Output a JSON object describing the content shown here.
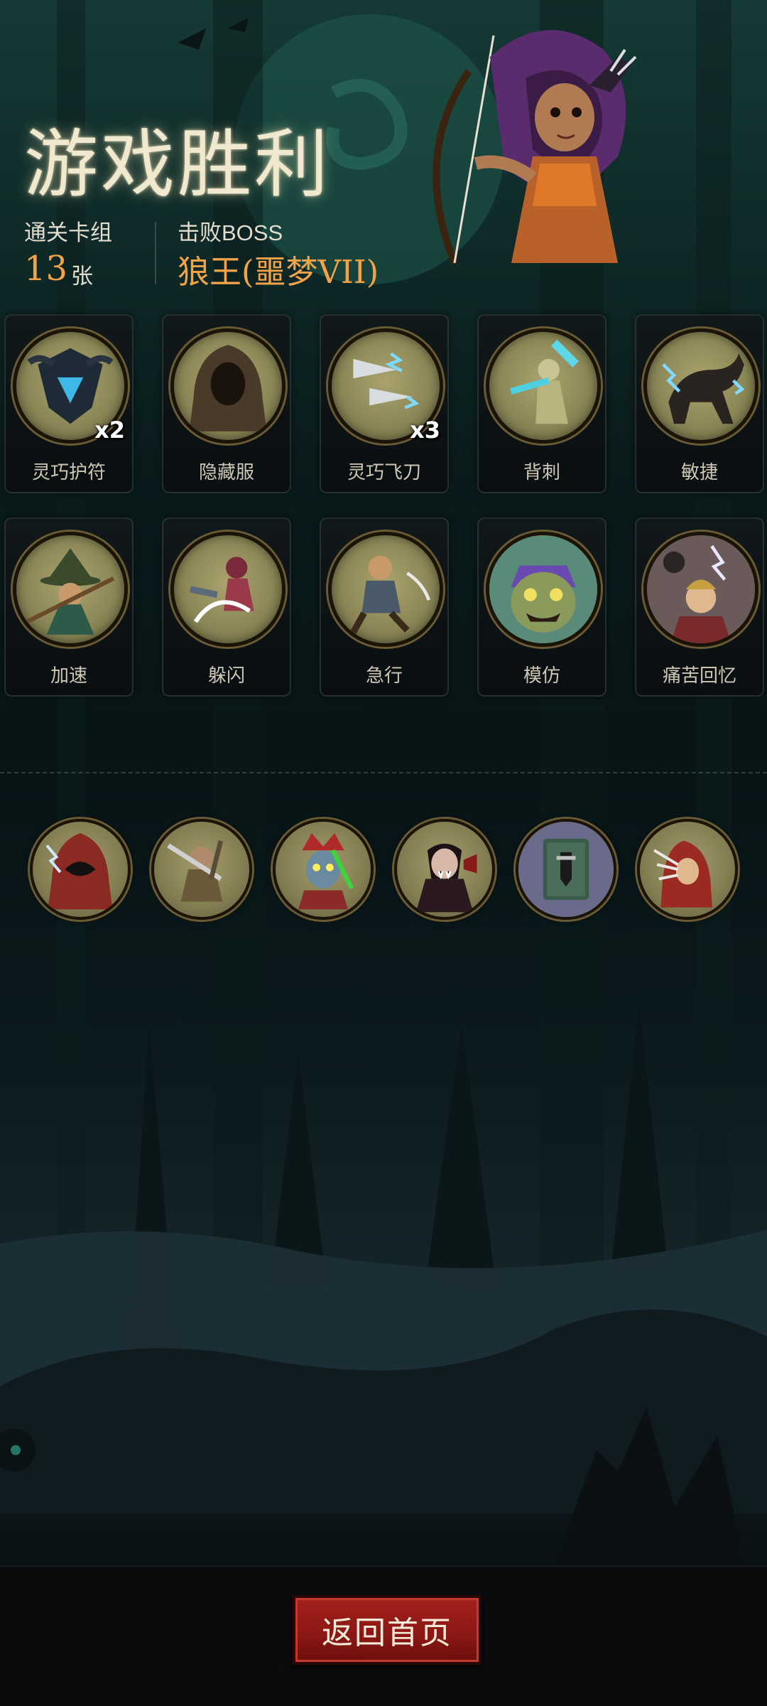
{
  "header": {
    "title": "游戏胜利",
    "deck_label": "通关卡组",
    "deck_count": "13",
    "deck_unit": "张",
    "boss_label": "击败BOSS",
    "boss_name": "狼王(噩梦VII)"
  },
  "cards": [
    {
      "label": "灵巧护符",
      "count": "x2",
      "icon": "amulet-icon"
    },
    {
      "label": "隐藏服",
      "count": "",
      "icon": "hood-icon"
    },
    {
      "label": "灵巧飞刀",
      "count": "x3",
      "icon": "throwing-knife-icon"
    },
    {
      "label": "背刺",
      "count": "",
      "icon": "backstab-icon"
    },
    {
      "label": "敏捷",
      "count": "",
      "icon": "panther-icon"
    },
    {
      "label": "加速",
      "count": "",
      "icon": "witch-icon"
    },
    {
      "label": "躲闪",
      "count": "",
      "icon": "dodge-icon"
    },
    {
      "label": "急行",
      "count": "",
      "icon": "dash-icon"
    },
    {
      "label": "模仿",
      "count": "",
      "icon": "goblin-face-icon"
    },
    {
      "label": "痛苦回忆",
      "count": "",
      "icon": "painful-memory-icon"
    }
  ],
  "relics": [
    {
      "icon": "hooded-figure-icon"
    },
    {
      "icon": "swordsman-icon"
    },
    {
      "icon": "jester-icon"
    },
    {
      "icon": "vampire-icon"
    },
    {
      "icon": "book-icon"
    },
    {
      "icon": "red-hood-icon"
    }
  ],
  "footer": {
    "home_button_label": "返回首页"
  },
  "colors": {
    "accent_orange": "#f2a347",
    "title_cream": "#f1e9cf",
    "button_red": "#a4201c",
    "card_bg": "#121a1c",
    "icon_olive": "#8c8757"
  }
}
